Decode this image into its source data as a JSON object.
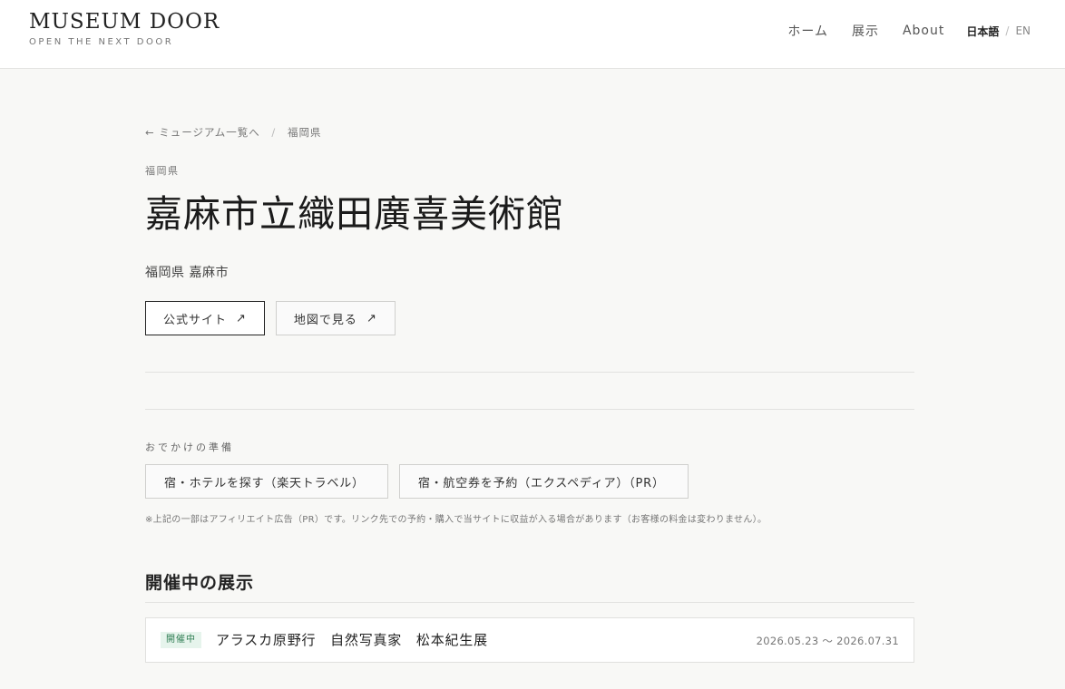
{
  "header": {
    "logo_title": "MUSEUM DOOR",
    "logo_tagline": "OPEN THE NEXT DOOR",
    "nav": [
      {
        "label": "ホーム"
      },
      {
        "label": "展示"
      },
      {
        "label": "About"
      }
    ],
    "lang_active": "日本語",
    "lang_separator": "/",
    "lang_other": "EN"
  },
  "breadcrumb": {
    "back_label": "← ミュージアム一覧へ",
    "separator": "/",
    "current": "福岡県"
  },
  "museum": {
    "prefecture_label": "福岡県",
    "name": "嘉麻市立織田廣喜美術館",
    "location": "福岡県 嘉麻市"
  },
  "actions": {
    "official_site_label": "公式サイト",
    "map_label": "地図で見る",
    "arrow_glyph": "↗"
  },
  "trip": {
    "section_label": "おでかけの準備",
    "hotel_label": "宿・ホテルを探す（楽天トラベル）",
    "flight_label": "宿・航空券を予約（エクスペディア）（PR）",
    "disclaimer": "※上記の一部はアフィリエイト広告（PR）です。リンク先での予約・購入で当サイトに収益が入る場合があります（お客様の料金は変わりません）。"
  },
  "exhibitions": {
    "heading": "開催中の展示",
    "items": [
      {
        "badge": "開催中",
        "title": "アラスカ原野行　自然写真家　松本紀生展",
        "dates": "2026.05.23 〜 2026.07.31"
      }
    ]
  },
  "colors": {
    "background": "#f8f8f6",
    "header_bg": "#ffffff",
    "badge_bg": "#e6f4ec",
    "badge_text": "#2f7d53"
  }
}
